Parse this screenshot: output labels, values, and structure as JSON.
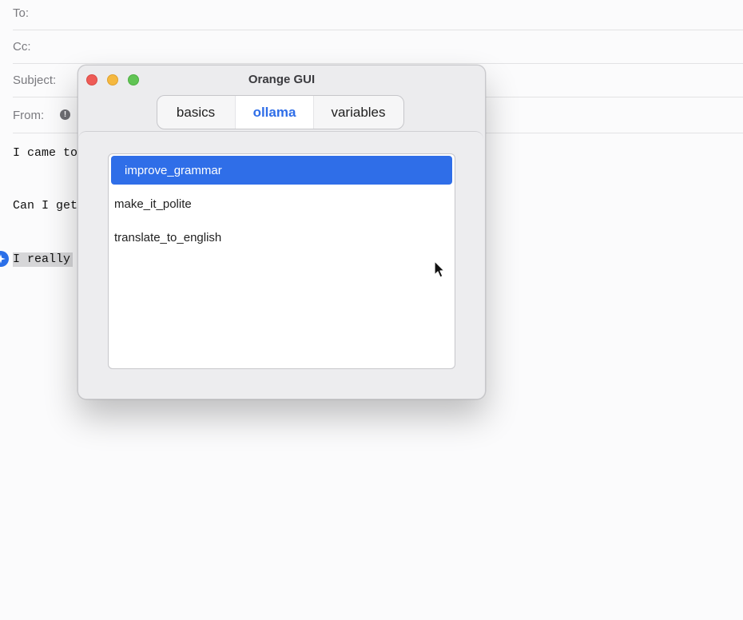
{
  "mail": {
    "fields": {
      "to": "To:",
      "cc": "Cc:",
      "subject": "Subject:",
      "from": "From:"
    },
    "body_lines": [
      "I came to",
      "Can I get",
      "I really"
    ]
  },
  "window": {
    "title": "Orange GUI",
    "tabs": [
      {
        "label": "basics"
      },
      {
        "label": "ollama"
      },
      {
        "label": "variables"
      }
    ],
    "list_items": [
      {
        "label": "improve_grammar"
      },
      {
        "label": "make_it_polite"
      },
      {
        "label": "translate_to_english"
      }
    ]
  },
  "colors": {
    "accent": "#2f6ee8",
    "close": "#ee5b56",
    "minimize": "#f5b83f",
    "zoom": "#61c454"
  },
  "icons": {
    "info": "info-circle-icon",
    "assistant": "assistant-sparkle-icon",
    "cursor": "mouse-pointer-icon"
  }
}
